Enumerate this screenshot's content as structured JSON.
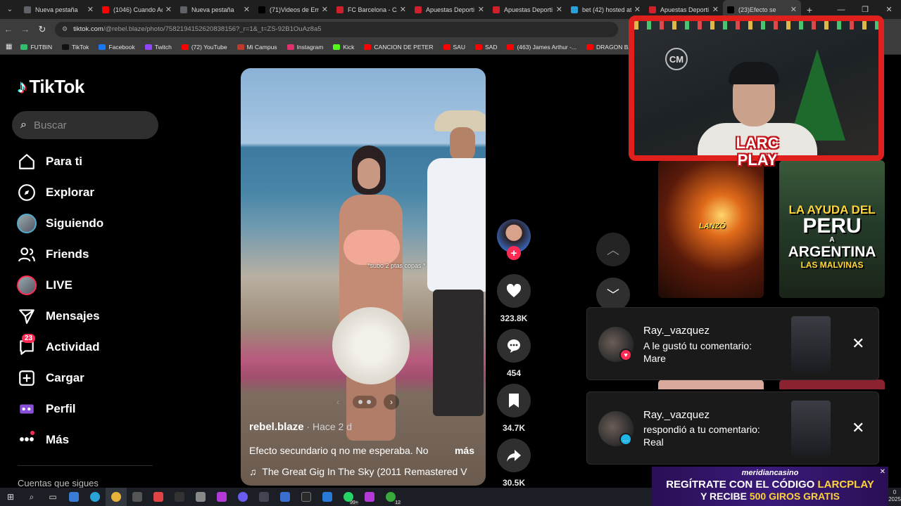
{
  "browser": {
    "tabs": [
      {
        "label": "Nueva pestaña",
        "color": "#5f6368"
      },
      {
        "label": "(1046) Cuando Ac",
        "color": "#ff0000"
      },
      {
        "label": "Nueva pestaña",
        "color": "#5f6368"
      },
      {
        "label": "(71)Videos de Em",
        "color": "#010101"
      },
      {
        "label": "FC Barcelona - CA",
        "color": "#d11f2b"
      },
      {
        "label": "Apuestas Deporti",
        "color": "#d11f2b"
      },
      {
        "label": "Apuestas Deporti",
        "color": "#d11f2b"
      },
      {
        "label": "bet (42) hosted at",
        "color": "#2a9fd8"
      },
      {
        "label": "Apuestas Deporti",
        "color": "#d11f2b"
      },
      {
        "label": "(23)Efecto se",
        "color": "#010101"
      }
    ],
    "url_host": "tiktok.com",
    "url_path": "/@rebel.blaze/photo/7582194152620838156?_r=1&_t=ZS-92B1OuAz8a5",
    "bookmarks": [
      {
        "label": "FUTBIN",
        "color": "#2fbf71"
      },
      {
        "label": "TikTok",
        "color": "#111111"
      },
      {
        "label": "Facebook",
        "color": "#1877f2"
      },
      {
        "label": "Twitch",
        "color": "#9146ff"
      },
      {
        "label": "(72) YouTube",
        "color": "#ff0000"
      },
      {
        "label": "Mi Campus",
        "color": "#c0392b"
      },
      {
        "label": "Instagram",
        "color": "#e1306c"
      },
      {
        "label": "Kick",
        "color": "#53fc18"
      },
      {
        "label": "CANCION DE PETER",
        "color": "#ff0000"
      },
      {
        "label": "SAU",
        "color": "#ff0000"
      },
      {
        "label": "SAD",
        "color": "#ff0000"
      },
      {
        "label": "(463) James Arthur -...",
        "color": "#ff0000"
      },
      {
        "label": "DRAGON BALL GT",
        "color": "#ff0000"
      },
      {
        "label": "AMOR",
        "color": "#ff0000"
      }
    ]
  },
  "sidebar": {
    "logo": "TikTok",
    "search_placeholder": "Buscar",
    "items": [
      {
        "label": "Para ti",
        "icon": "home-icon"
      },
      {
        "label": "Explorar",
        "icon": "compass-icon"
      },
      {
        "label": "Siguiendo",
        "icon": "following-avatar"
      },
      {
        "label": "Friends",
        "icon": "friends-icon"
      },
      {
        "label": "LIVE",
        "icon": "live-avatar"
      },
      {
        "label": "Mensajes",
        "icon": "send-icon"
      },
      {
        "label": "Actividad",
        "icon": "activity-icon",
        "badge": "23"
      },
      {
        "label": "Cargar",
        "icon": "upload-icon"
      },
      {
        "label": "Perfil",
        "icon": "profile-icon"
      },
      {
        "label": "Más",
        "icon": "more-icon"
      }
    ],
    "following_title": "Cuentas que sigues"
  },
  "video": {
    "overlay_text": "*subo 2 ptas copas *",
    "author": "rebel.blaze",
    "time": " · Hace 2 d",
    "description": "Efecto secundario q no me esperaba. No",
    "more": "más",
    "music": "The Great Gig In The Sky (2011 Remastered V"
  },
  "actions": {
    "likes": "323.8K",
    "comments": "454",
    "saves": "34.7K",
    "shares": "30.5K"
  },
  "stream_overlay": {
    "channel_badge_l1": "LARC",
    "channel_badge_l2": "PLAY",
    "logo_text": "CM"
  },
  "tiles": {
    "tile1_label": "LANZÓ",
    "tile2_l1": "LA AYUDA DEL",
    "tile2_l2": "PERU",
    "tile2_l3": "A",
    "tile2_l4": "ARGENTINA",
    "tile2_l5": "LAS MALVINAS"
  },
  "notifications": [
    {
      "user": "Ray._vazquez",
      "line1": "A le gustó tu comentario:",
      "line2": "Mare",
      "type": "like"
    },
    {
      "user": "Ray._vazquez",
      "line1": "respondió a tu comentario:",
      "line2": "Real",
      "type": "reply"
    }
  ],
  "promo": {
    "brand": "meridiancasino",
    "line1_a": "REGÍTRATE CON EL CÓDIGO",
    "line1_b": "LARCPLAY",
    "line2_a": "Y RECIBE",
    "line2_b": "500 GIROS GRATIS"
  },
  "taskbar": {
    "badge_whatsapp": "99+",
    "badge_xbox": "12",
    "clock_fragment": "0",
    "year_fragment": "2025"
  }
}
